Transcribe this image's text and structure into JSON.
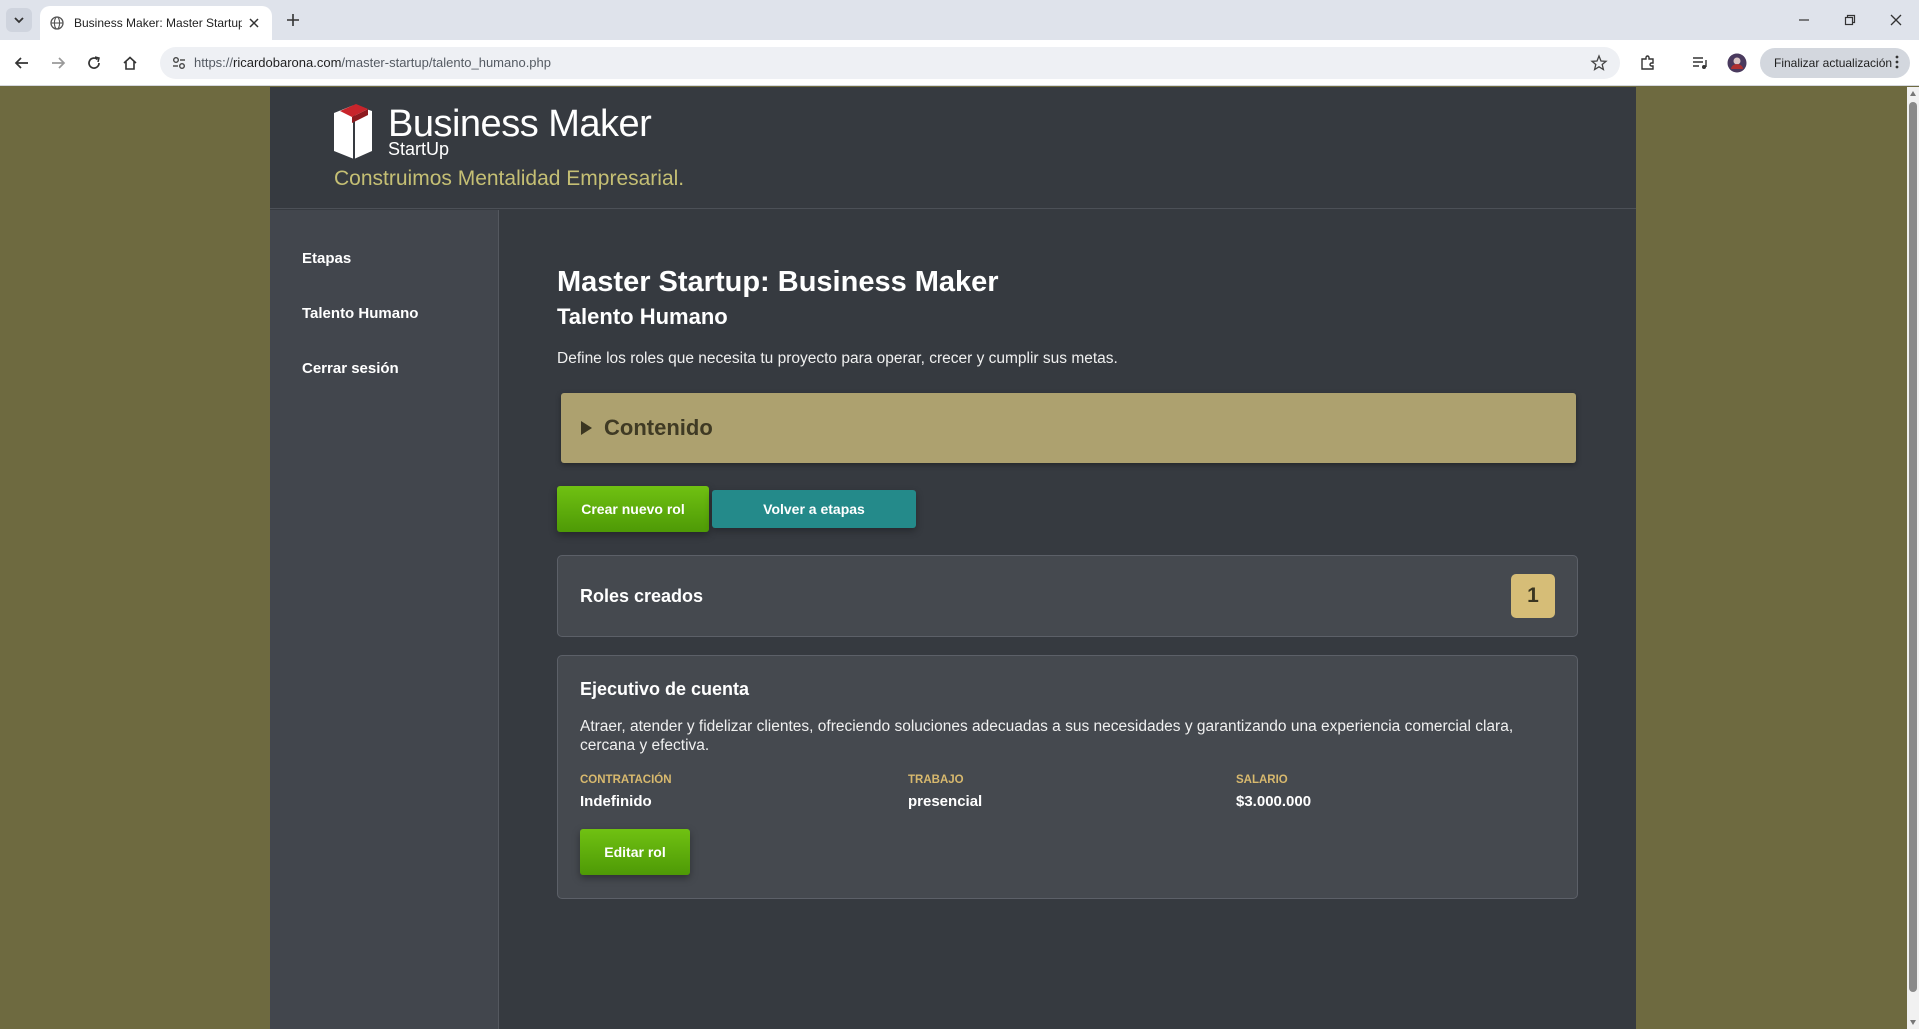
{
  "browser": {
    "tab_title": "Business Maker: Master Startup",
    "url_host": "ricardobarona.com",
    "url_prefix": "https://",
    "url_path": "/master-startup/talento_humano.php",
    "update_label": "Finalizar actualización"
  },
  "site": {
    "brand_name": "Business Maker",
    "brand_sub": "StartUp",
    "tagline": "Construimos Mentalidad Empresarial."
  },
  "sidebar": {
    "items": [
      {
        "label": "Etapas"
      },
      {
        "label": "Talento Humano"
      },
      {
        "label": "Cerrar sesión"
      }
    ]
  },
  "main": {
    "title": "Master Startup: Business Maker",
    "subtitle": "Talento Humano",
    "description": "Define los roles que necesita tu proyecto para operar, crecer y cumplir sus metas.",
    "accordion_label": "Contenido",
    "create_button": "Crear nuevo rol",
    "back_button": "Volver a etapas",
    "roles_header": "Roles creados",
    "roles_count": "1"
  },
  "roles": [
    {
      "name": "Ejecutivo de cuenta",
      "description": "Atraer, atender y fidelizar clientes, ofreciendo soluciones adecuadas a sus necesidades y garantizando una experiencia comercial clara, cercana y efectiva.",
      "contract_label": "CONTRATACIÓN",
      "contract_value": "Indefinido",
      "work_label": "TRABAJO",
      "work_value": "presencial",
      "salary_label": "SALARIO",
      "salary_value": "$3.000.000",
      "edit_button": "Editar rol"
    }
  ],
  "colors": {
    "page_background": "#6e6a40",
    "panel": "#363a40",
    "accent_gold": "#ada16f",
    "button_green": "#5aab0a",
    "button_teal": "#248a8a",
    "tagline": "#c5bf74"
  }
}
